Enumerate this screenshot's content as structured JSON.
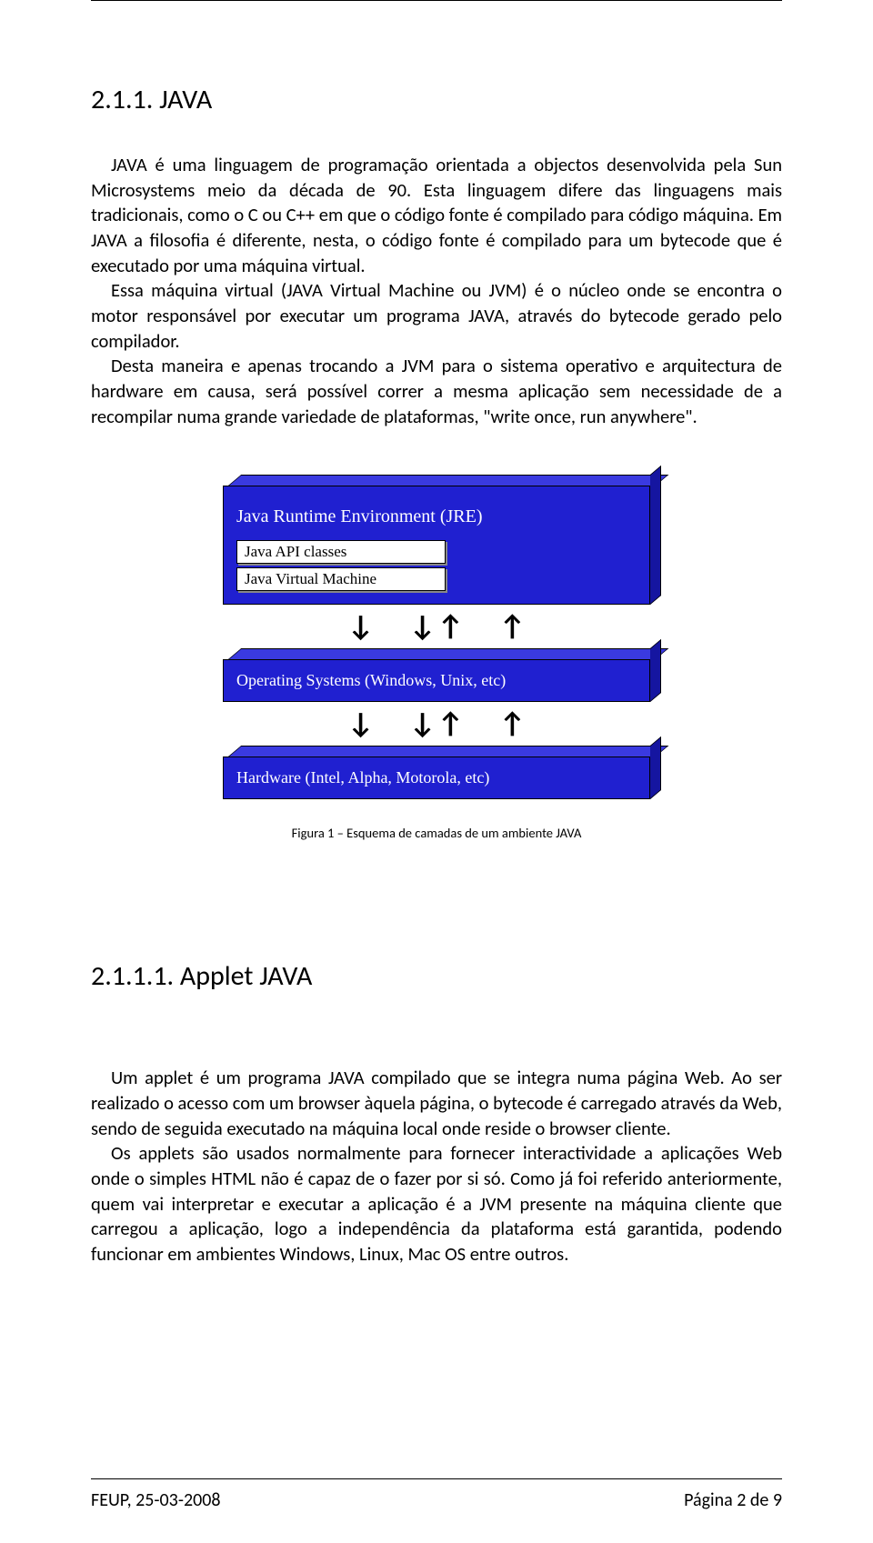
{
  "section1": {
    "heading": "2.1.1. JAVA",
    "para": "JAVA é uma linguagem de programação orientada a objectos desenvolvida pela Sun Microsystems meio da década de 90. Esta linguagem difere das linguagens mais tradicionais, como o C ou C++ em que o código fonte é compilado para código máquina. Em JAVA a filosofia é diferente, nesta, o código fonte é compilado para um bytecode que é executado por uma máquina virtual.",
    "para2": "Essa máquina virtual (JAVA Virtual Machine ou JVM) é o núcleo onde se encontra o motor responsável por executar um programa JAVA, através do bytecode gerado pelo compilador.",
    "para3": "Desta maneira e apenas trocando a JVM para o sistema operativo e arquitectura de hardware em causa, será possível correr a mesma aplicação sem necessidade de a recompilar numa grande variedade de plataformas, \"write once, run anywhere\"."
  },
  "diagram": {
    "jre": "Java Runtime Environment (JRE)",
    "api": "Java API classes",
    "jvm": "Java Virtual Machine",
    "os": "Operating Systems (Windows, Unix, etc)",
    "hw": "Hardware (Intel, Alpha, Motorola, etc)",
    "caption": "Figura 1 – Esquema de camadas de um ambiente JAVA"
  },
  "section2": {
    "heading": "2.1.1.1. Applet JAVA",
    "para": "Um applet é um programa JAVA compilado que se integra numa página Web. Ao ser realizado o acesso com um browser àquela página, o bytecode é carregado através da Web, sendo de seguida executado na máquina local onde reside o browser cliente.",
    "para2": "Os applets são usados normalmente para fornecer interactividade a aplicações Web onde o simples HTML não é capaz de o fazer por si só. Como já foi referido anteriormente, quem vai interpretar e executar a aplicação é a JVM presente na máquina cliente que carregou a aplicação, logo a independência da plataforma está garantida, podendo funcionar em ambientes Windows, Linux, Mac OS entre outros."
  },
  "footer": {
    "left": "FEUP, 25-03-2008",
    "right": "Página 2 de 9"
  }
}
